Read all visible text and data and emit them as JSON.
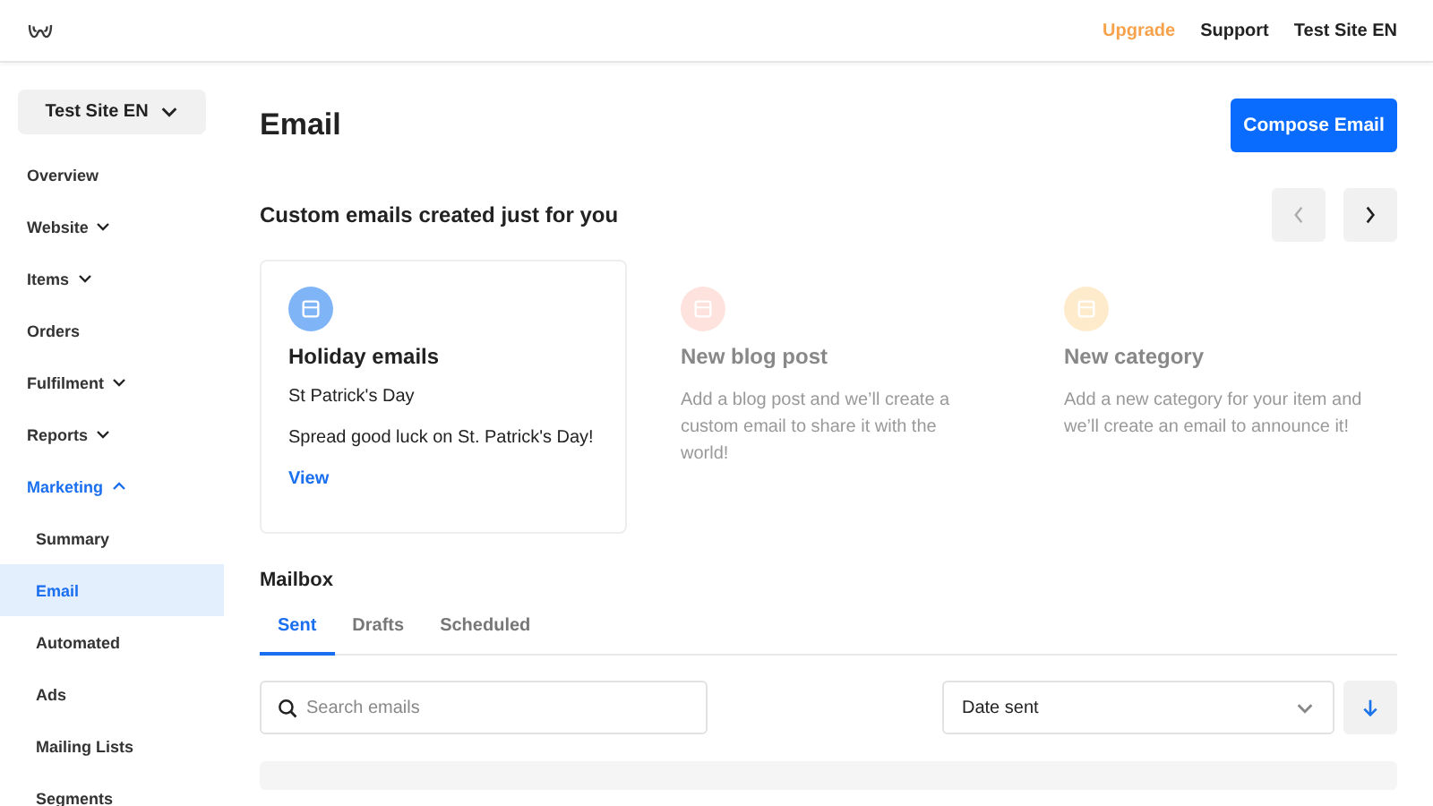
{
  "topbar": {
    "links": [
      {
        "label": "Upgrade",
        "kind": "upgrade"
      },
      {
        "label": "Support",
        "kind": "plain"
      },
      {
        "label": "Test Site EN",
        "kind": "plain"
      }
    ]
  },
  "sidebar": {
    "site_selector": "Test Site EN",
    "items": [
      {
        "label": "Overview",
        "kind": "link",
        "selected": false
      },
      {
        "label": "Website",
        "kind": "group",
        "expanded": false,
        "selected": false
      },
      {
        "label": "Items",
        "kind": "group",
        "expanded": false,
        "selected": false
      },
      {
        "label": "Orders",
        "kind": "link",
        "selected": false
      },
      {
        "label": "Fulfilment",
        "kind": "group",
        "expanded": false,
        "selected": false
      },
      {
        "label": "Reports",
        "kind": "group",
        "expanded": false,
        "selected": false
      },
      {
        "label": "Marketing",
        "kind": "group",
        "expanded": true,
        "selected": true,
        "children": [
          {
            "label": "Summary",
            "selected": false
          },
          {
            "label": "Email",
            "selected": true
          },
          {
            "label": "Automated",
            "selected": false
          },
          {
            "label": "Ads",
            "selected": false
          },
          {
            "label": "Mailing Lists",
            "selected": false
          },
          {
            "label": "Segments",
            "selected": false
          }
        ]
      }
    ]
  },
  "page": {
    "title": "Email",
    "compose_button": "Compose Email"
  },
  "suggestions": {
    "heading": "Custom emails created just for you",
    "prev_disabled": true,
    "cards": [
      {
        "title": "Holiday emails",
        "disabled": false,
        "color": "#7fb4f6",
        "lines": [
          "St Patrick's Day",
          "Spread good luck on St. Patrick's Day!"
        ],
        "link": "View"
      },
      {
        "title": "New blog post",
        "disabled": true,
        "color": "#fde2dd",
        "lines": [
          "Add a blog post and we’ll create a custom email to share it with the world!"
        ]
      },
      {
        "title": "New category",
        "disabled": true,
        "color": "#fdebcb",
        "lines": [
          "Add a new category for your item and we’ll create an email to announce it!"
        ]
      }
    ]
  },
  "mailbox": {
    "heading": "Mailbox",
    "tabs": [
      {
        "label": "Sent",
        "selected": true
      },
      {
        "label": "Drafts",
        "selected": false
      },
      {
        "label": "Scheduled",
        "selected": false
      }
    ],
    "search": {
      "placeholder": "Search emails"
    },
    "sort": {
      "value": "Date sent"
    }
  }
}
